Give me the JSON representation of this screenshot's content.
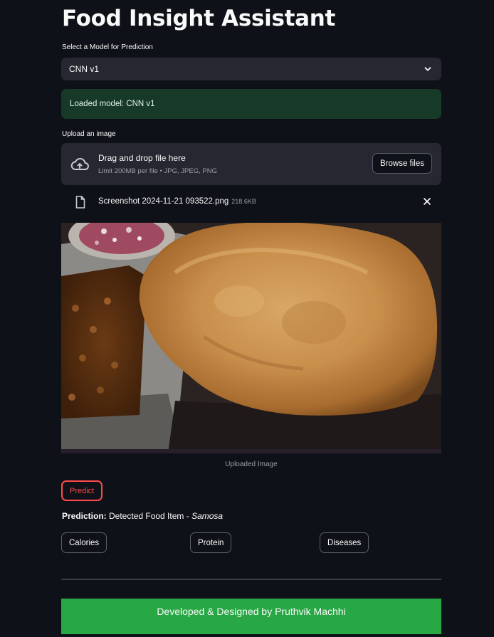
{
  "app": {
    "title": "Food Insight Assistant"
  },
  "model_select": {
    "label": "Select a Model for Prediction",
    "selected": "CNN v1"
  },
  "status": {
    "message": "Loaded model: CNN v1",
    "color": "#173928"
  },
  "uploader": {
    "label": "Upload an image",
    "drop_text": "Drag and drop file here",
    "limit_text": "Limit 200MB per file • JPG, JPEG, PNG",
    "browse_label": "Browse files",
    "file": {
      "name": "Screenshot 2024-11-21 093522.png",
      "size": "218.6KB"
    }
  },
  "image": {
    "caption": "Uploaded Image"
  },
  "predict": {
    "label": "Predict",
    "accent": "#ff4b4b"
  },
  "prediction": {
    "label": "Prediction:",
    "text": " Detected Food Item - ",
    "item": "Samosa"
  },
  "nutrition_buttons": [
    "Calories",
    "Protein",
    "Diseases"
  ],
  "footer": {
    "text": "Developed & Designed by Pruthvik Machhi",
    "color": "#28a745"
  },
  "icons": [
    "chevron-down-icon",
    "cloud-upload-icon",
    "file-icon",
    "close-icon"
  ]
}
